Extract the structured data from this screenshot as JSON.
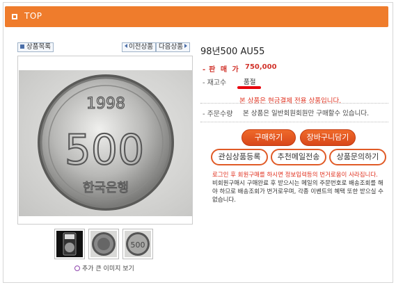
{
  "header": {
    "title": "TOP"
  },
  "nav": {
    "list": "상품목록",
    "prev": "이전상품",
    "next": "다음상품"
  },
  "coin": {
    "year": "1998",
    "value": "500",
    "country": "한국은행"
  },
  "product": {
    "title": "98년500 AU55",
    "price_label": "판 매 가",
    "price": "750,000",
    "stock_label": "재고수",
    "stock_value": "품절",
    "cash_notice": "본 상품은 현금결제 전용 상품입니다.",
    "qty_label": "주문수량",
    "qty_notice": "본 상품은 일반회원회원만 구매할수 있습니다."
  },
  "buttons": {
    "buy": "구매하기",
    "cart": "장바구니담기",
    "wishlist": "관심상품등록",
    "recommend_mail": "추천메일전송",
    "inquiry": "상품문의하기"
  },
  "notices": {
    "login": "로그인 후 회원구매를 하시면 정보입력등의 번거로움이 사라집니다.",
    "guest": "비회원구매시 구매완료 후 받으시는 메일의 주문번호로 배송조회를 해야 하므로 배송조회가 번거로우며, 각종 이벤트의 혜택 또한 받으실 수 없습니다."
  },
  "gallery": {
    "zoom_link": "추가 큰 이미지 보기"
  },
  "colors": {
    "accent": "#ef7c2c",
    "price": "#d1322a",
    "notice": "#e0301e"
  }
}
